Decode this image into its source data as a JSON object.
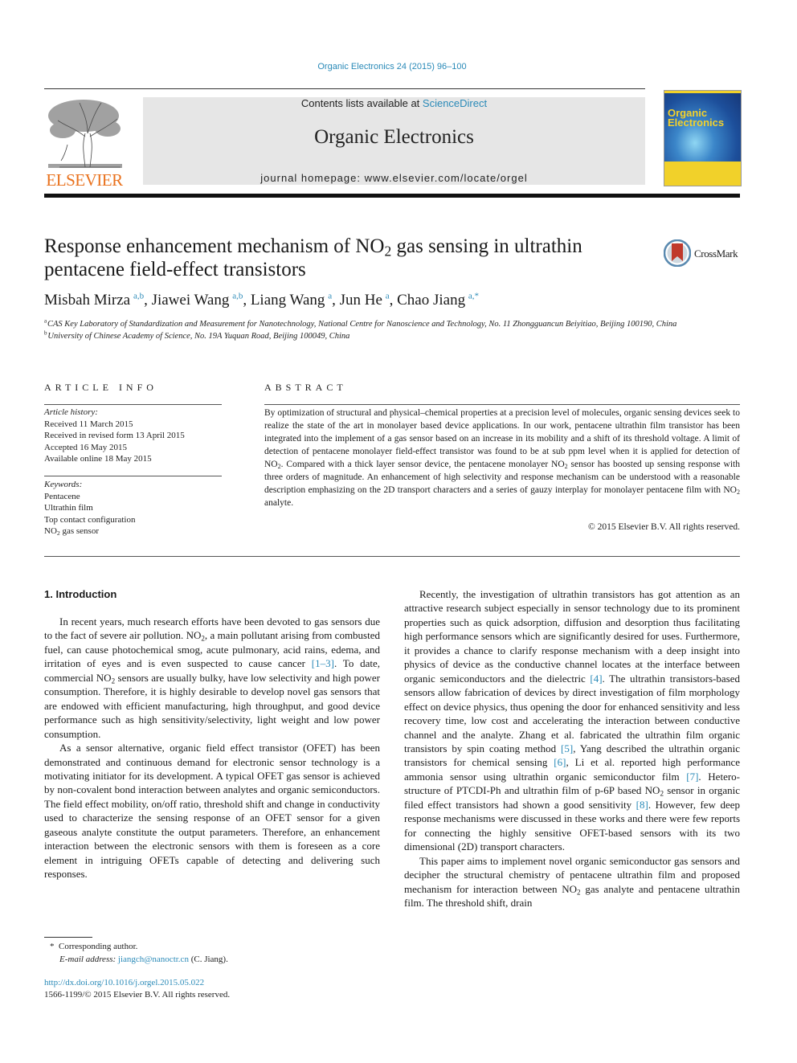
{
  "header": {
    "citation": "Organic Electronics 24 (2015) 96–100",
    "contents_prefix": "Contents lists available at ",
    "contents_link": "ScienceDirect",
    "journal_name": "Organic Electronics",
    "homepage": "journal homepage: www.elsevier.com/locate/orgel",
    "publisher_logo_text": "ELSEVIER",
    "publisher_logo_icon": "elsevier-tree-icon",
    "cover_title_line1": "Organic",
    "cover_title_line2": "Electronics",
    "colors": {
      "publisher_orange": "#e9711c",
      "link_blue": "#2a8ab8",
      "cover_yellow": "#f1d12a",
      "banner_gray": "#e6e6e6"
    }
  },
  "article": {
    "title_part1": "Response enhancement mechanism of NO",
    "title_sub": "2",
    "title_part2": " gas sensing in ultrathin pentacene field-effect transistors",
    "crossmark_label": "CrossMark",
    "authors": [
      {
        "name": "Misbah Mirza",
        "aff": "a,b",
        "sep": ", "
      },
      {
        "name": "Jiawei Wang",
        "aff": "a,b",
        "sep": ", "
      },
      {
        "name": "Liang Wang",
        "aff": "a",
        "sep": ", "
      },
      {
        "name": "Jun He",
        "aff": "a",
        "sep": ", "
      },
      {
        "name": "Chao Jiang",
        "aff": "a,*",
        "sep": ""
      }
    ],
    "affiliations": [
      {
        "key": "a",
        "text": "CAS Key Laboratory of Standardization and Measurement for Nanotechnology, National Centre for Nanoscience and Technology, No. 11 Zhongguancun Beiyitiao, Beijing 100190, China"
      },
      {
        "key": "b",
        "text": "University of Chinese Academy of Science, No. 19A Yuquan Road, Beijing 100049, China"
      }
    ]
  },
  "article_info": {
    "heading": "ARTICLE INFO",
    "history_label": "Article history:",
    "history": [
      "Received 11 March 2015",
      "Received in revised form 13 April 2015",
      "Accepted 16 May 2015",
      "Available online 18 May 2015"
    ],
    "keywords_label": "Keywords:",
    "keywords": [
      "Pentacene",
      "Ultrathin film",
      "Top contact configuration"
    ],
    "keyword_last_pre": "NO",
    "keyword_last_sub": "2",
    "keyword_last_post": " gas sensor"
  },
  "abstract": {
    "heading": "ABSTRACT",
    "seg1": "By optimization of structural and physical–chemical properties at a precision level of molecules, organic sensing devices seek to realize the state of the art in monolayer based device applications. In our work, pentacene ultrathin film transistor has been integrated into the implement of a gas sensor based on an increase in its mobility and a shift of its threshold voltage. A limit of detection of pentacene monolayer field-effect transistor was found to be at sub ppm level when it is applied for detection of NO",
    "seg2": ". Compared with a thick layer sensor device, the pentacene monolayer NO",
    "seg3": " sensor has boosted up sensing response with three orders of magnitude. An enhancement of high selectivity and response mechanism can be understood with a reasonable description emphasizing on the 2D transport characters and a series of gauzy interplay for monolayer pentacene film with NO",
    "seg4": " analyte.",
    "sub": "2",
    "copyright": "© 2015 Elsevier B.V. All rights reserved."
  },
  "body": {
    "section_heading": "1. Introduction",
    "left_p1": {
      "a": "In recent years, much research efforts have been devoted to gas sensors due to the fact of severe air pollution. NO",
      "b": ", a main pollutant arising from combusted fuel, can cause photochemical smog, acute pulmonary, acid rains, edema, and irritation of eyes and is even suspected to cause cancer ",
      "ref1": "[1–3]",
      "c": ". To date, commercial NO",
      "d": " sensors are usually bulky, have low selectivity and high power consumption. Therefore, it is highly desirable to develop novel gas sensors that are endowed with efficient manufacturing, high throughput, and good device performance such as high sensitivity/selectivity, light weight and low power consumption."
    },
    "left_p2": "As a sensor alternative, organic field effect transistor (OFET) has been demonstrated and continuous demand for electronic sensor technology is a motivating initiator for its development. A typical OFET gas sensor is achieved by non-covalent bond interaction between analytes and organic semiconductors. The field effect mobility, on/off ratio, threshold shift and change in conductivity used to characterize the sensing response of an OFET sensor for a given gaseous analyte constitute the output parameters. Therefore, an enhancement interaction between the electronic sensors with them is foreseen as a core element in intriguing OFETs capable of detecting and delivering such responses.",
    "right_p1": {
      "a": "Recently, the investigation of ultrathin transistors has got attention as an attractive research subject especially in sensor technology due to its prominent properties such as quick adsorption, diffusion and desorption thus facilitating high performance sensors which are significantly desired for uses. Furthermore, it provides a chance to clarify response mechanism with a deep insight into physics of device as the conductive channel locates at the interface between organic semiconductors and the dielectric ",
      "ref4": "[4]",
      "b": ". The ultrathin transistors-based sensors allow fabrication of devices by direct investigation of film morphology effect on device physics, thus opening the door for enhanced sensitivity and less recovery time, low cost and accelerating the interaction between conductive channel and the analyte. Zhang et al. fabricated the ultrathin film organic transistors by spin coating method ",
      "ref5": "[5]",
      "c": ", Yang described the ultrathin organic transistors for chemical sensing ",
      "ref6": "[6]",
      "d": ", Li et al. reported high performance ammonia sensor using ultrathin organic semiconductor film ",
      "ref7": "[7]",
      "e": ". Hetero-structure of PTCDI-Ph and ultrathin film of p-6P based NO",
      "f": " sensor in organic filed effect transistors had shown a good sensitivity ",
      "ref8": "[8]",
      "g": ". However, few deep response mechanisms were discussed in these works and there were few reports for connecting the highly sensitive OFET-based sensors with its two dimensional (2D) transport characters."
    },
    "right_p2": {
      "a": "This paper aims to implement novel organic semiconductor gas sensors and decipher the structural chemistry of pentacene ultrathin film and proposed mechanism for interaction between NO",
      "b": " gas analyte and pentacene ultrathin film. The threshold shift, drain"
    },
    "sub": "2"
  },
  "footnotes": {
    "star": "*",
    "corresponding": "Corresponding author.",
    "email_label": "E-mail address:",
    "email": "jiangch@nanoctr.cn",
    "email_owner": " (C. Jiang).",
    "doi": "http://dx.doi.org/10.1016/j.orgel.2015.05.022",
    "issn": "1566-1199/© 2015 Elsevier B.V. All rights reserved."
  }
}
